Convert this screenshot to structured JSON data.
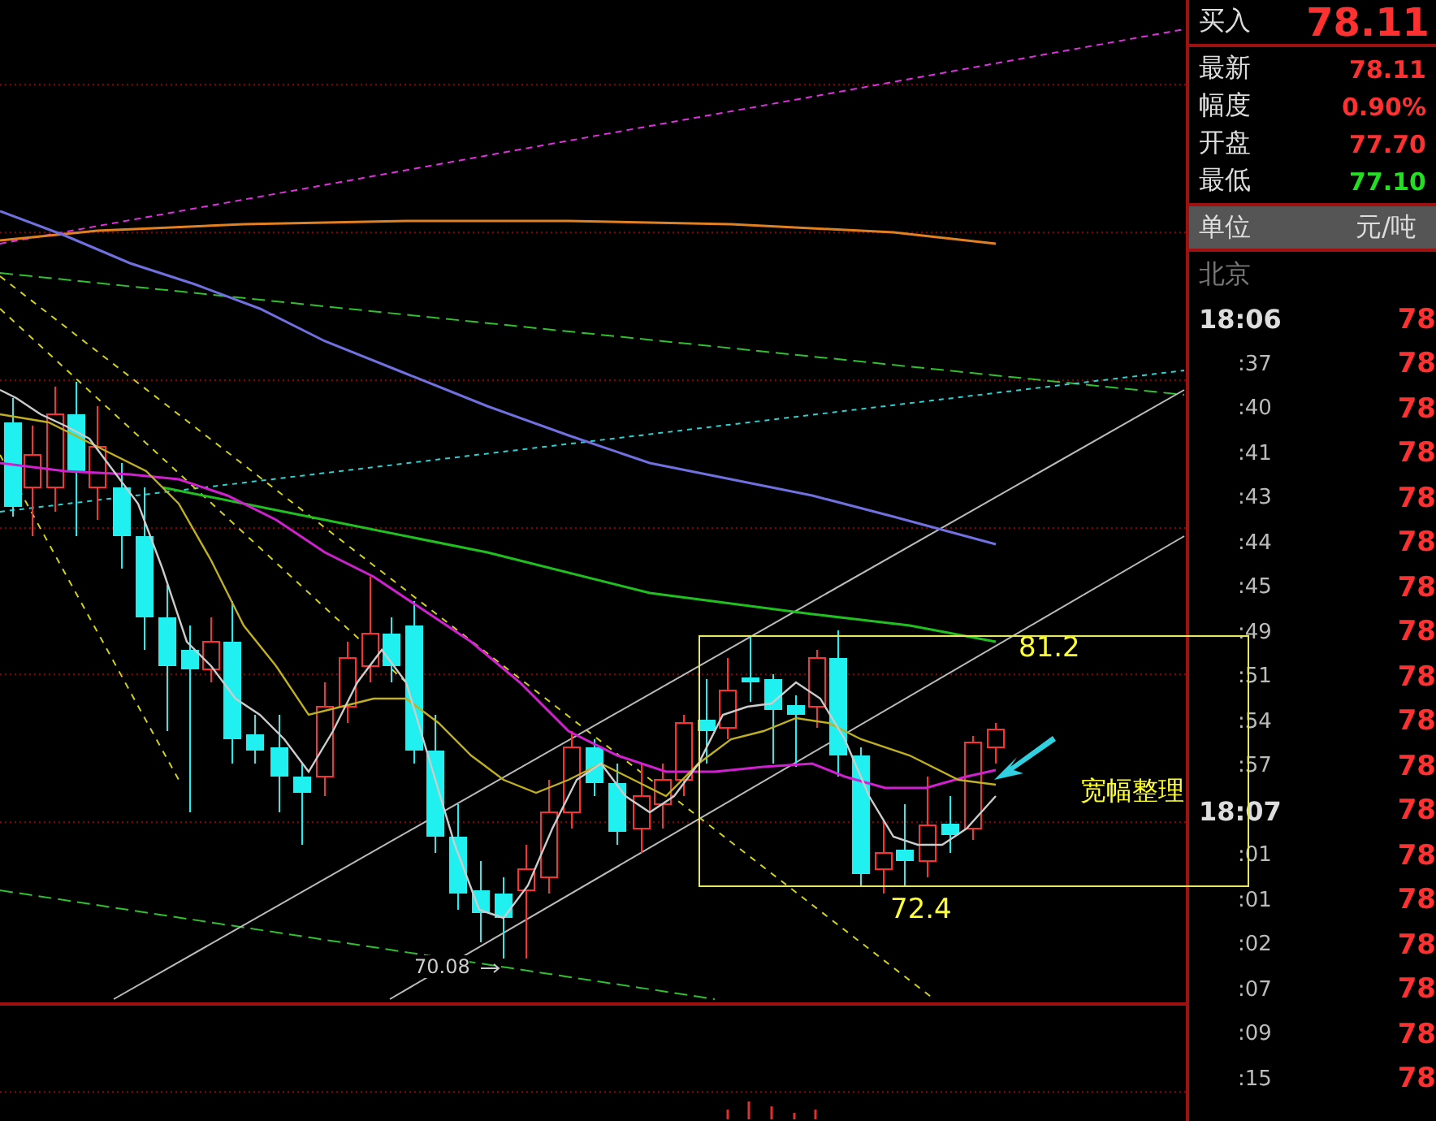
{
  "quote": {
    "bid": {
      "label": "买入",
      "value": "78.11"
    },
    "rows": [
      {
        "label": "最新",
        "value": "78.11",
        "color": "#ff3030"
      },
      {
        "label": "幅度",
        "value": "0.90%",
        "color": "#ff3030"
      },
      {
        "label": "开盘",
        "value": "77.70",
        "color": "#ff3030"
      },
      {
        "label": "最低",
        "value": "77.10",
        "color": "#20e020"
      }
    ],
    "unit": {
      "label": "单位",
      "value": "元/吨"
    }
  },
  "ticks": {
    "header": "北京",
    "rows": [
      {
        "time": "18:06",
        "kind": "hour",
        "price": "78"
      },
      {
        "time": ":37",
        "kind": "minute",
        "price": "78"
      },
      {
        "time": ":40",
        "kind": "minute",
        "price": "78"
      },
      {
        "time": ":41",
        "kind": "minute",
        "price": "78"
      },
      {
        "time": ":43",
        "kind": "minute",
        "price": "78"
      },
      {
        "time": ":44",
        "kind": "minute",
        "price": "78"
      },
      {
        "time": ":45",
        "kind": "minute",
        "price": "78"
      },
      {
        "time": ":49",
        "kind": "minute",
        "price": "78"
      },
      {
        "time": ":51",
        "kind": "minute",
        "price": "78"
      },
      {
        "time": ":54",
        "kind": "minute",
        "price": "78"
      },
      {
        "time": ":57",
        "kind": "minute",
        "price": "78"
      },
      {
        "time": "18:07",
        "kind": "hour",
        "price": "78"
      },
      {
        "time": ":01",
        "kind": "minute",
        "price": "78"
      },
      {
        "time": ":01",
        "kind": "minute",
        "price": "78"
      },
      {
        "time": ":02",
        "kind": "minute",
        "price": "78"
      },
      {
        "time": ":07",
        "kind": "minute",
        "price": "78"
      },
      {
        "time": ":09",
        "kind": "minute",
        "price": "78"
      },
      {
        "time": ":15",
        "kind": "minute",
        "price": "78"
      }
    ]
  },
  "chart": {
    "high_label": "81.2",
    "low_label": "72.4",
    "range_note": "宽幅整理",
    "low_marker": "70.08"
  }
}
